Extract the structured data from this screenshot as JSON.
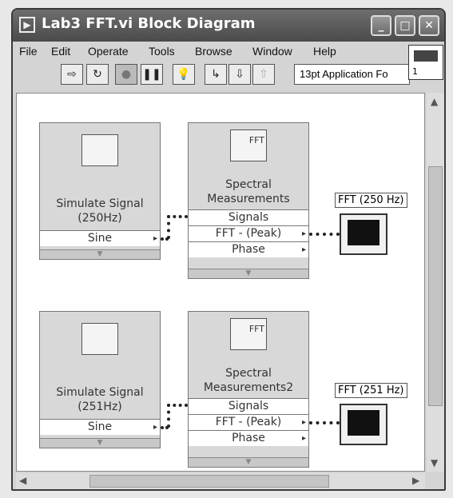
{
  "window": {
    "title": "Lab3 FFT.vi Block Diagram",
    "controls": {
      "minimize": "_",
      "maximize": "□",
      "close": "✕"
    }
  },
  "menu": [
    "File",
    "Edit",
    "Operate",
    "Tools",
    "Browse",
    "Window",
    "Help"
  ],
  "toolbar": {
    "font_value": "13pt Application Fo",
    "vi_icon_number": "1"
  },
  "nodes": {
    "sim1": {
      "label": "Simulate Signal (250Hz)",
      "line1": "Simulate Signal",
      "line2": "(250Hz)",
      "output": "Sine"
    },
    "spec1": {
      "line1": "Spectral",
      "line2": "Measurements",
      "in": "Signals",
      "out1": "FFT - (Peak)",
      "out2": "Phase"
    },
    "graph1": {
      "label": "FFT (250 Hz)"
    },
    "sim2": {
      "line1": "Simulate Signal",
      "line2": "(251Hz)",
      "output": "Sine"
    },
    "spec2": {
      "line1": "Spectral",
      "line2": "Measurements2",
      "in": "Signals",
      "out1": "FFT - (Peak)",
      "out2": "Phase"
    },
    "graph2": {
      "label": "FFT (251 Hz)"
    }
  },
  "icons": {
    "spectral_text": "FFT"
  }
}
